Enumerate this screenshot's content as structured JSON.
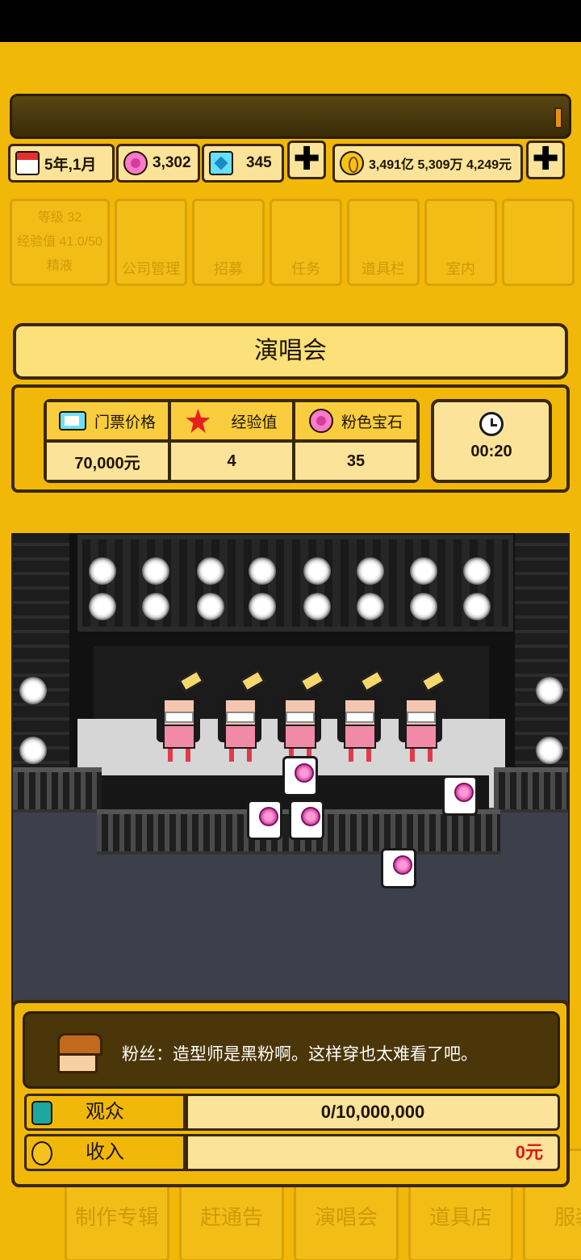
{
  "resources": {
    "date": "5年,1月",
    "pink_gems": "3,302",
    "diamonds": "345",
    "money": "3,491亿 5,309万 4,249元",
    "plus_symbol": "✚"
  },
  "menu": {
    "level_label": "等级",
    "level_value": "32",
    "exp_label": "经验值",
    "exp_value": "41.0/50",
    "essence_label": "精液",
    "tabs": [
      "公司管理",
      "招募",
      "任务",
      "道具栏",
      "室内"
    ]
  },
  "bottom_nav": [
    "制作专辑",
    "赶通告",
    "演唱会",
    "道具店",
    "服装"
  ],
  "concert": {
    "title": "演唱会",
    "stats": {
      "ticket_label": "门票价格",
      "ticket_value": "70,000元",
      "exp_label": "经验值",
      "exp_value": "4",
      "gem_label": "粉色宝石",
      "gem_value": "35"
    },
    "timer": "00:20",
    "fan_message": "粉丝：造型师是黑粉啊。这样穿也太难看了吧。",
    "audience_label": "观众",
    "audience_value": "0/10,000,000",
    "income_label": "收入",
    "income_value": "0元"
  },
  "colors": {
    "background": "#f1b80a",
    "panel_light": "#fbe39a",
    "border": "#3a2704",
    "income_red": "#e0180c"
  }
}
